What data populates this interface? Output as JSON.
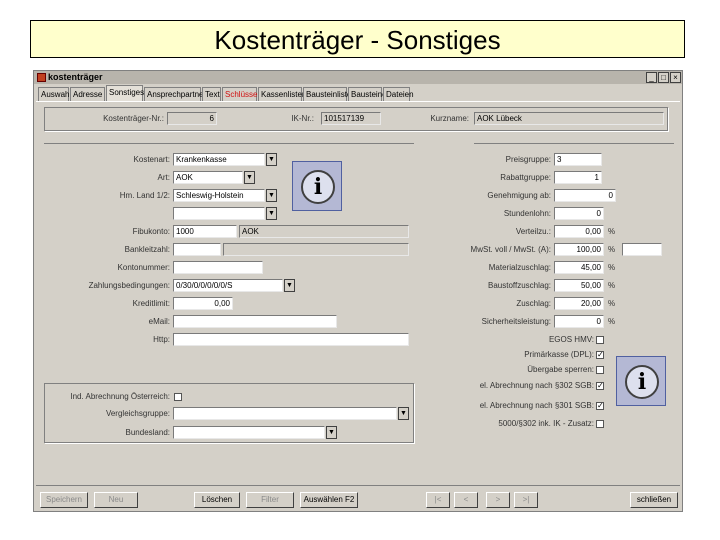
{
  "banner": {
    "title": "Kostenträger - Sonstiges"
  },
  "window": {
    "title": "kostenträger",
    "min": "_",
    "max": "□",
    "close": "×"
  },
  "tabs": [
    {
      "label": "Auswahl"
    },
    {
      "label": "Adresse"
    },
    {
      "label": "Sonstiges",
      "active": true
    },
    {
      "label": "Ansprechpartner"
    },
    {
      "label": "Text"
    },
    {
      "label": "Schlüssel",
      "color": "#d01010"
    },
    {
      "label": "Kassenlisten"
    },
    {
      "label": "Bausteinliste"
    },
    {
      "label": "Bausteine"
    },
    {
      "label": "Dateien"
    }
  ],
  "header": {
    "nr_label": "Kostenträger-Nr.:",
    "nr_value": "6",
    "ik_label": "IK-Nr.:",
    "ik_value": "101517139",
    "kurz_label": "Kurzname:",
    "kurz_value": "AOK Lübeck"
  },
  "left": {
    "kostenart": {
      "label": "Kostenart:",
      "value": "Krankenkasse"
    },
    "art": {
      "label": "Art:",
      "value": "AOK"
    },
    "land": {
      "label": "Hm. Land 1/2:",
      "value": "Schleswig-Holstein",
      "value2": ""
    },
    "fibukonto": {
      "label": "Fibukonto:",
      "value": "1000",
      "name": "AOK"
    },
    "bankleitzahl": {
      "label": "Bankleitzahl:",
      "value": "",
      "name": ""
    },
    "kontonummer": {
      "label": "Kontonummer:",
      "value": ""
    },
    "zahlung": {
      "label": "Zahlungsbedingungen:",
      "value": "0/30/0/0/0/0/0/S"
    },
    "kreditlimit": {
      "label": "Kreditlimit:",
      "value": "0,00"
    },
    "email": {
      "label": "eMail:",
      "value": ""
    },
    "http": {
      "label": "Http:",
      "value": ""
    }
  },
  "lower": {
    "abrechnung": {
      "label": "Ind. Abrechnung Österreich:"
    },
    "vergleich": {
      "label": "Vergleichsgruppe:",
      "value": ""
    },
    "bundesland": {
      "label": "Bundesland:",
      "value": ""
    }
  },
  "right": {
    "preisgruppe": {
      "label": "Preisgruppe:",
      "value": "3"
    },
    "rabattgruppe": {
      "label": "Rabattgruppe:",
      "value": "1"
    },
    "genehmigung": {
      "label": "Genehmigung ab:",
      "value": "0"
    },
    "stundenlohn": {
      "label": "Stundenlohn:",
      "value": "0"
    },
    "verteilzu": {
      "label": "Verteilzu.:",
      "value": "0,00",
      "unit": "%"
    },
    "mwst": {
      "label": "MwSt. voll / MwSt. (A):",
      "value": "100,00",
      "unit": "%",
      "value2": ""
    },
    "materialzuschlag": {
      "label": "Materialzuschlag:",
      "value": "45,00",
      "unit": "%"
    },
    "bauzuschlag": {
      "label": "Baustoffzuschlag:",
      "value": "50,00",
      "unit": "%"
    },
    "zuschlag": {
      "label": "Zuschlag:",
      "value": "20,00",
      "unit": "%"
    },
    "sicherheit": {
      "label": "Sicherheitsleistung:",
      "value": "0",
      "unit": "%"
    },
    "checks": [
      {
        "label": "EGOS HMV:",
        "checked": false
      },
      {
        "label": "Primärkasse (DPL):",
        "checked": true
      },
      {
        "label": "Übergabe sperren:",
        "checked": false
      },
      {
        "label": "el. Abrechnung nach §302 SGB:",
        "checked": true
      },
      {
        "label": "el. Abrechnung nach §301 SGB:",
        "checked": true
      },
      {
        "label": "5000/§302 ink. IK - Zusatz:",
        "checked": false
      }
    ],
    "check_mark": "✓"
  },
  "info": {
    "glyph": "i"
  },
  "buttons": {
    "speichern": "Speichern",
    "neu": "Neu",
    "loeschen": "Löschen",
    "filter": "Filter",
    "auswahl": "Auswählen F2",
    "first": "|<",
    "prev": "<",
    "next": ">",
    "last": ">|",
    "schliessen": "schließen"
  },
  "colors": {
    "window_bg": "#d4d0c8",
    "banner_bg": "#ffffcc",
    "info_bg": "#b4b8d4",
    "active_red": "#d01010"
  }
}
